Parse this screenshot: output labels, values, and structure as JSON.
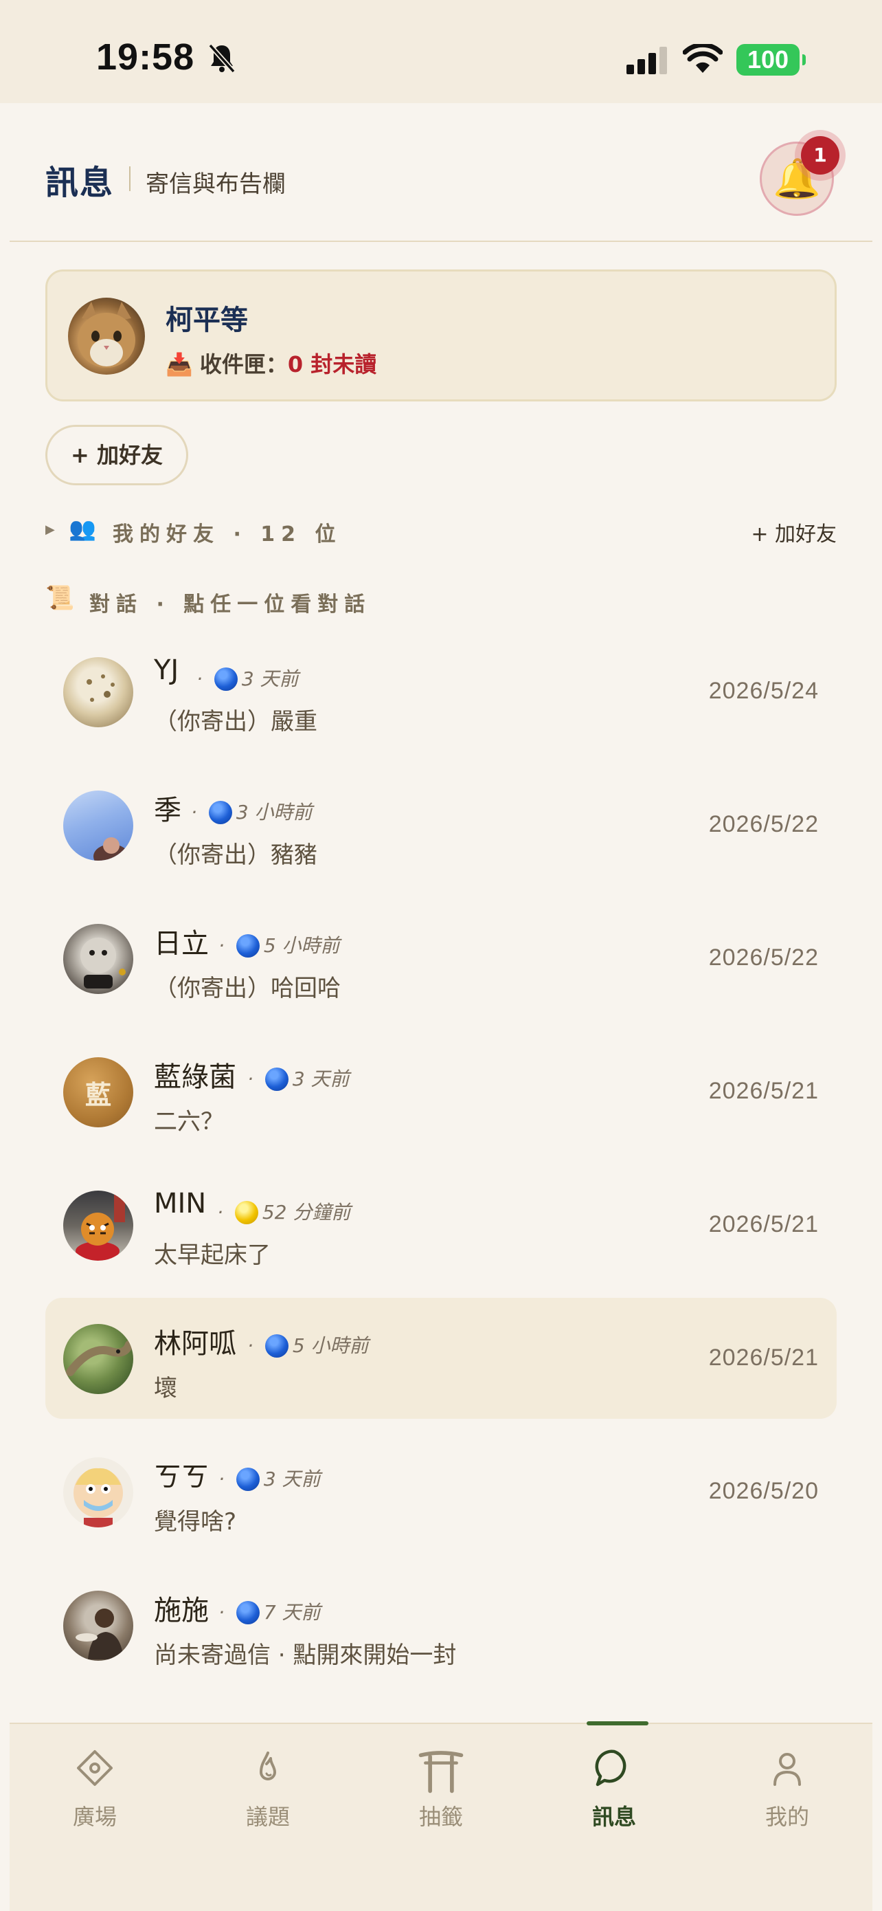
{
  "status_bar": {
    "time": "19:58",
    "battery": "100"
  },
  "header": {
    "title": "訊息",
    "subtitle": "寄信與布告欄",
    "notification_count": "1"
  },
  "profile": {
    "name": "柯平等",
    "inbox_label": "收件匣：",
    "unread_text": "0 封未讀"
  },
  "add_friend_button": "+ 加好友",
  "friends_section": {
    "label": "我的好友 · 12 位",
    "add_label": "+ 加好友"
  },
  "conversations_section": {
    "label": "對話 · 點任一位看對話"
  },
  "conversations": [
    {
      "name": "YJ",
      "meta": "3 天前",
      "status": "blue",
      "message": "（你寄出）嚴重",
      "date": "2026/5/24"
    },
    {
      "name": "季",
      "meta": "3 小時前",
      "status": "blue",
      "message": "（你寄出）豬豬",
      "date": "2026/5/22"
    },
    {
      "name": "日立",
      "meta": "5 小時前",
      "status": "blue",
      "message": "（你寄出）哈回哈",
      "date": "2026/5/22"
    },
    {
      "name": "藍綠菌",
      "meta": "3 天前",
      "status": "blue",
      "message": "二六？",
      "date": "2026/5/21",
      "avatar_letter": "藍"
    },
    {
      "name": "MIN",
      "meta": "52 分鐘前",
      "status": "yellow",
      "message": "太早起床了",
      "date": "2026/5/21"
    },
    {
      "name": "林阿呱",
      "meta": "5 小時前",
      "status": "blue",
      "message": "壞",
      "date": "2026/5/21"
    },
    {
      "name": "ㄎㄎ",
      "meta": "3 天前",
      "status": "blue",
      "message": "覺得啥?",
      "date": "2026/5/20"
    },
    {
      "name": "施施",
      "meta": "7 天前",
      "status": "blue",
      "message": "尚未寄過信 · 點開來開始一封",
      "date": ""
    }
  ],
  "nav": [
    {
      "label": "廣場",
      "icon": "diamond-icon"
    },
    {
      "label": "議題",
      "icon": "flame-icon"
    },
    {
      "label": "抽籤",
      "icon": "torii-gate-icon"
    },
    {
      "label": "訊息",
      "icon": "chat-bubble-icon"
    },
    {
      "label": "我的",
      "icon": "person-icon"
    }
  ],
  "colors": {
    "accent": "#3f6b2e",
    "title": "#1b2f54",
    "badge": "#b8222c",
    "background": "#f8f4ee"
  }
}
